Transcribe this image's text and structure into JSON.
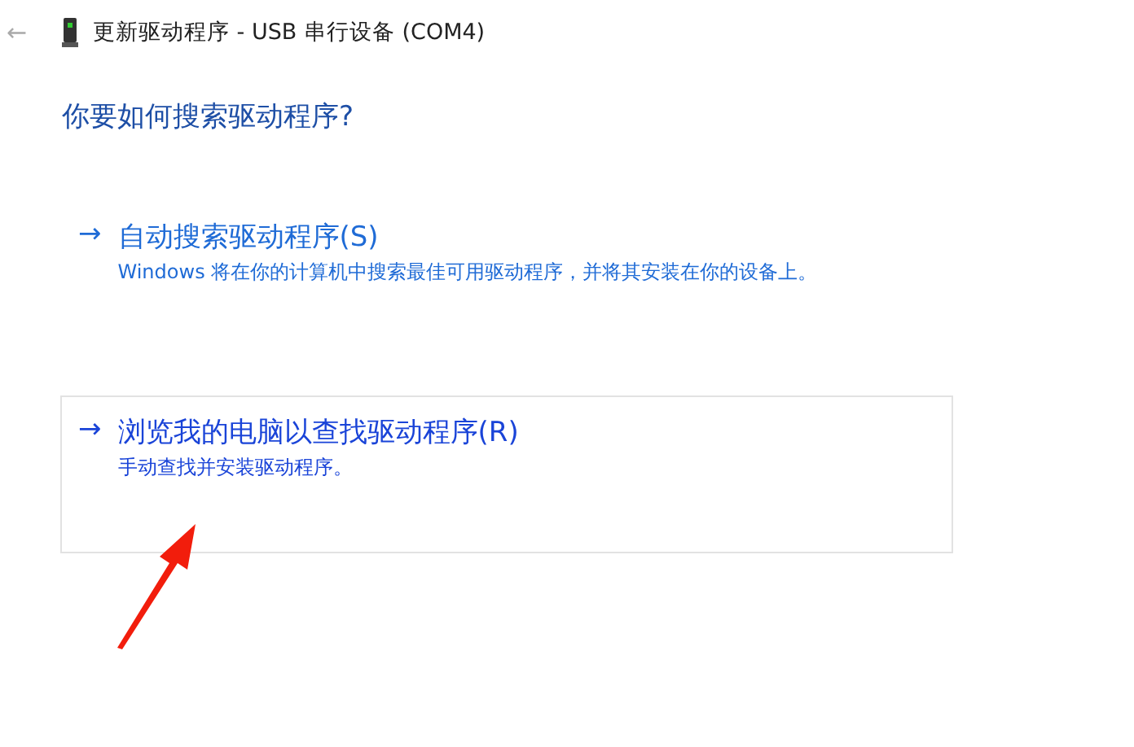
{
  "window": {
    "back": "←",
    "title": "更新驱动程序 - USB 串行设备 (COM4)"
  },
  "heading": "你要如何搜索驱动程序?",
  "options": [
    {
      "arrow": "→",
      "label": "自动搜索驱动程序(S)",
      "description": "Windows 将在你的计算机中搜索最佳可用驱动程序，并将其安装在你的设备上。",
      "selected": false
    },
    {
      "arrow": "→",
      "label": "浏览我的电脑以查找驱动程序(R)",
      "description": "手动查找并安装驱动程序。",
      "selected": true
    }
  ]
}
